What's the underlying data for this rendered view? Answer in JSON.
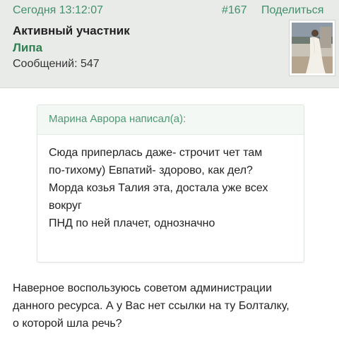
{
  "post": {
    "time": "Сегодня 13:12:07",
    "number": "#167",
    "share_label": "Поделиться"
  },
  "author": {
    "title": "Активный участник",
    "name": "Липа",
    "posts": "Сообщений: 547"
  },
  "quote": {
    "header": "Марина Аврора написал(а):",
    "lines": [
      "Сюда приперлась даже- строчит чет там",
      "по-тихому) Евпатий- здорово, как дел?",
      "Морда козья Талия эта, достала уже всех",
      "вокруг",
      "ПНД по ней плачет, однозначно"
    ]
  },
  "reply": {
    "lines": [
      "Наверное воспользуюсь советом администрации",
      "данного ресурса. А у Вас нет ссылки на ту Болталку,",
      "о которой шла речь?"
    ]
  },
  "colors": {
    "accent": "#3f8f6a",
    "author_name": "#2f7f53",
    "header_bg": "#e9ebe9"
  }
}
